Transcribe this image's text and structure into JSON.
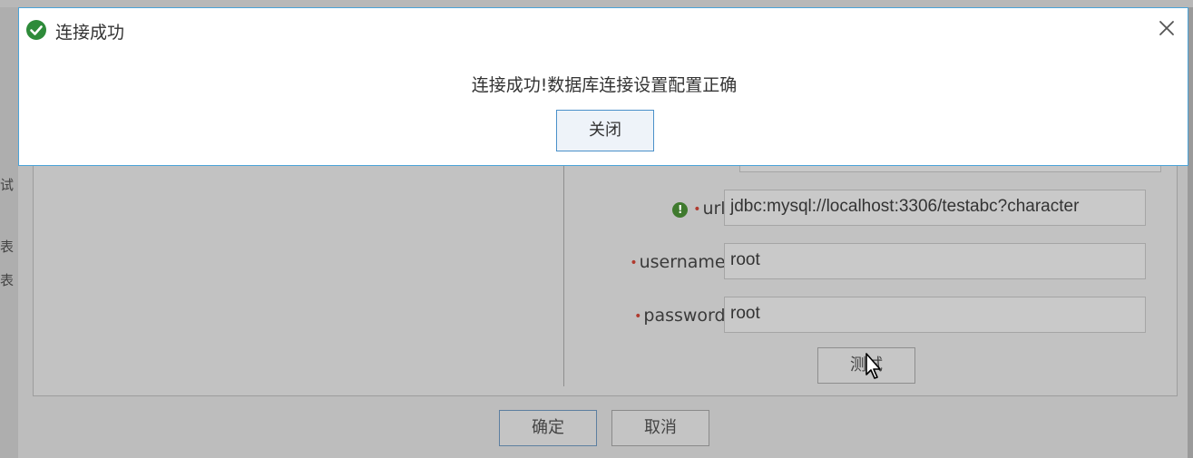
{
  "modal": {
    "title": "连接成功",
    "message": "连接成功!数据库连接设置配置正确",
    "close_button": "关闭",
    "icon": "check-circle-icon",
    "close_icon": "close-x-icon"
  },
  "background": {
    "strip_chars": [
      "试",
      "表",
      "表"
    ]
  },
  "form": {
    "url": {
      "label": "url:",
      "value": "jdbc:mysql://localhost:3306/testabc?character"
    },
    "username": {
      "label": "username:",
      "value": "root"
    },
    "password": {
      "label": "password:",
      "value": "root"
    },
    "test_button": "测试"
  },
  "footer": {
    "confirm": "确定",
    "cancel": "取消"
  },
  "colors": {
    "accent": "#4aa3d8",
    "success": "#2e8b3a",
    "required": "#b03a2e"
  }
}
